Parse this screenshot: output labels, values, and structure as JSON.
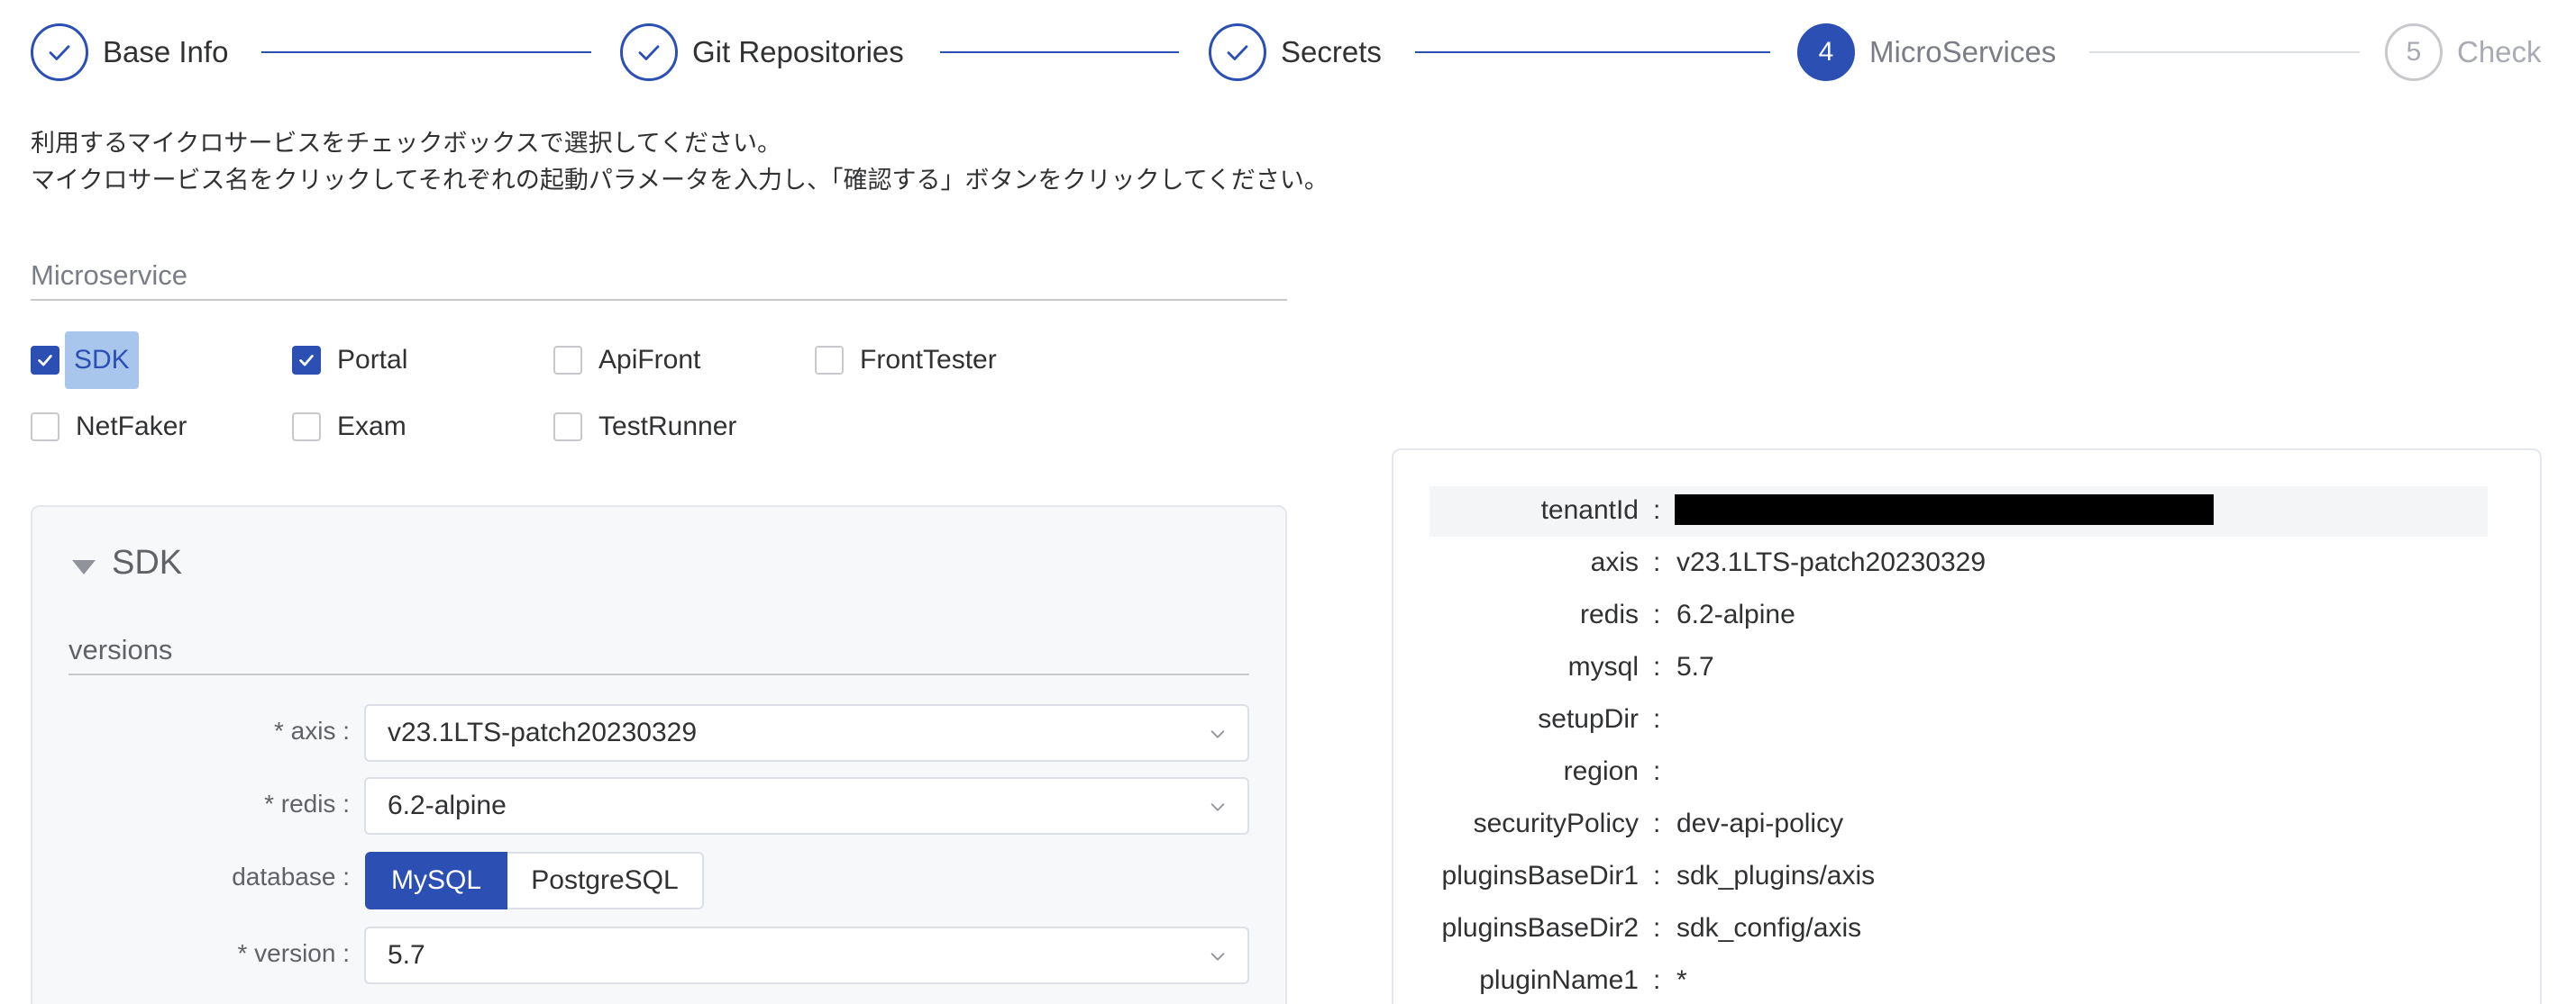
{
  "stepper": {
    "steps": [
      {
        "number": "1",
        "label": "Base Info",
        "state": "done"
      },
      {
        "number": "2",
        "label": "Git Repositories",
        "state": "done"
      },
      {
        "number": "3",
        "label": "Secrets",
        "state": "done"
      },
      {
        "number": "4",
        "label": "MicroServices",
        "state": "active"
      },
      {
        "number": "5",
        "label": "Check",
        "state": "pending"
      }
    ]
  },
  "instructions": {
    "line1": "利用するマイクロサービスをチェックボックスで選択してください。",
    "line2": "マイクロサービス名をクリックしてそれぞれの起動パラメータを入力し、「確認する」ボタンをクリックしてください。"
  },
  "microservice": {
    "title": "Microservice",
    "options": [
      {
        "label": "SDK",
        "checked": true,
        "highlighted": true
      },
      {
        "label": "Portal",
        "checked": true
      },
      {
        "label": "ApiFront",
        "checked": false
      },
      {
        "label": "FrontTester",
        "checked": false
      },
      {
        "label": "NetFaker",
        "checked": false
      },
      {
        "label": "Exam",
        "checked": false
      },
      {
        "label": "TestRunner",
        "checked": false
      }
    ]
  },
  "sdk_panel": {
    "title": "SDK",
    "versions_title": "versions",
    "axis": {
      "label": "* axis :",
      "value": "v23.1LTS-patch20230329"
    },
    "redis": {
      "label": "* redis :",
      "value": "6.2-alpine"
    },
    "database": {
      "label": "database :",
      "options": [
        "MySQL",
        "PostgreSQL"
      ],
      "selected": "MySQL"
    },
    "version": {
      "label": "* version :",
      "value": "5.7"
    }
  },
  "summary": {
    "colon": ":",
    "rows": [
      {
        "key": "tenantId",
        "value": "",
        "redacted": true
      },
      {
        "key": "axis",
        "value": "v23.1LTS-patch20230329"
      },
      {
        "key": "redis",
        "value": "6.2-alpine"
      },
      {
        "key": "mysql",
        "value": "5.7"
      },
      {
        "key": "setupDir",
        "value": ""
      },
      {
        "key": "region",
        "value": ""
      },
      {
        "key": "securityPolicy",
        "value": "dev-api-policy"
      },
      {
        "key": "pluginsBaseDir1",
        "value": "sdk_plugins/axis"
      },
      {
        "key": "pluginsBaseDir2",
        "value": "sdk_config/axis"
      },
      {
        "key": "pluginName1",
        "value": "*"
      }
    ]
  },
  "colors": {
    "accent": "#2c4fb3",
    "highlight": "#a8c6ec",
    "muted": "#7a7d85"
  }
}
